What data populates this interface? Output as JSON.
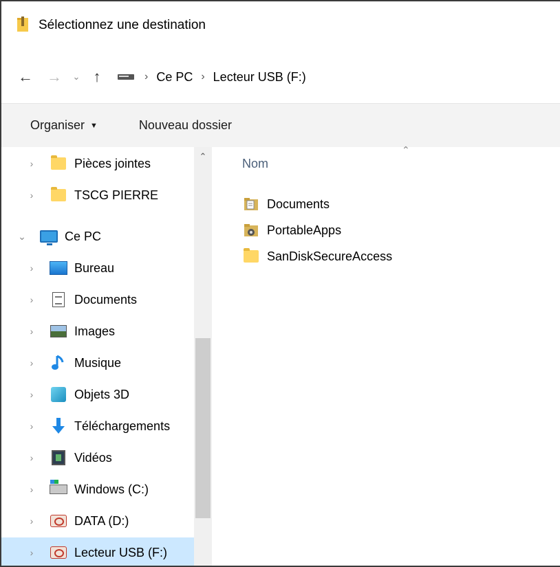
{
  "window": {
    "title": "Sélectionnez une destination"
  },
  "nav": {
    "back_glyph": "←",
    "forward_glyph": "→",
    "recent_glyph": "⌄",
    "up_glyph": "↑",
    "breadcrumb": [
      "Ce PC",
      "Lecteur USB (F:)"
    ],
    "separator": "›"
  },
  "toolbar": {
    "organize_label": "Organiser",
    "organize_caret": "▼",
    "new_folder_label": "Nouveau dossier"
  },
  "sidebar": {
    "items": [
      {
        "label": "Pièces jointes",
        "icon": "folder-icon"
      },
      {
        "label": "TSCG PIERRE",
        "icon": "folder-icon"
      },
      {
        "label": "Ce PC",
        "icon": "pc-icon",
        "expanded": true
      },
      {
        "label": "Bureau",
        "icon": "desktop-icon"
      },
      {
        "label": "Documents",
        "icon": "documents-icon"
      },
      {
        "label": "Images",
        "icon": "images-icon"
      },
      {
        "label": "Musique",
        "icon": "music-icon"
      },
      {
        "label": "Objets 3D",
        "icon": "3d-objects-icon"
      },
      {
        "label": "Téléchargements",
        "icon": "downloads-icon"
      },
      {
        "label": "Vidéos",
        "icon": "videos-icon"
      },
      {
        "label": "Windows (C:)",
        "icon": "drive-c-icon"
      },
      {
        "label": "DATA (D:)",
        "icon": "drive-d-icon"
      },
      {
        "label": "Lecteur USB (F:)",
        "icon": "usb-drive-icon",
        "selected": true
      }
    ]
  },
  "content": {
    "column_name": "Nom",
    "files": [
      {
        "label": "Documents",
        "icon": "documents-folder-icon"
      },
      {
        "label": "PortableApps",
        "icon": "portableapps-folder-icon"
      },
      {
        "label": "SanDiskSecureAccess",
        "icon": "folder-icon"
      }
    ]
  },
  "colors": {
    "selected_bg": "#cce8ff",
    "toolbar_bg": "#f3f3f3",
    "column_header": "#4c607a"
  }
}
